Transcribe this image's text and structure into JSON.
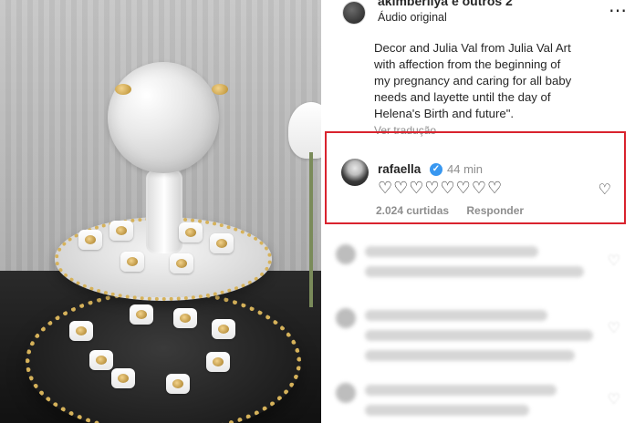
{
  "post": {
    "header": {
      "username": "akimberliya e outros 2",
      "audio": "Áudio original",
      "more": "⋯"
    },
    "caption_lines": [
      "Decor and Julia Val from Julia Val Art",
      "with affection from the beginning of",
      "my pregnancy and caring for all baby",
      "needs and layette until the day of",
      "Helena's Birth and future\"."
    ],
    "see_translation": "Ver tradução"
  },
  "highlighted_comment": {
    "username": "rafaella",
    "verified_icon": "verified-check-icon",
    "time": "44 min",
    "text_hearts": "♡♡♡♡♡♡♡♡",
    "likes": "2.024 curtidas",
    "reply": "Responder",
    "like_icon": "heart-outline-icon"
  },
  "colors": {
    "highlight_border": "#d9232e",
    "verified_blue": "#3897f0",
    "text": "#262626",
    "secondary_text": "#8e8e8e"
  }
}
